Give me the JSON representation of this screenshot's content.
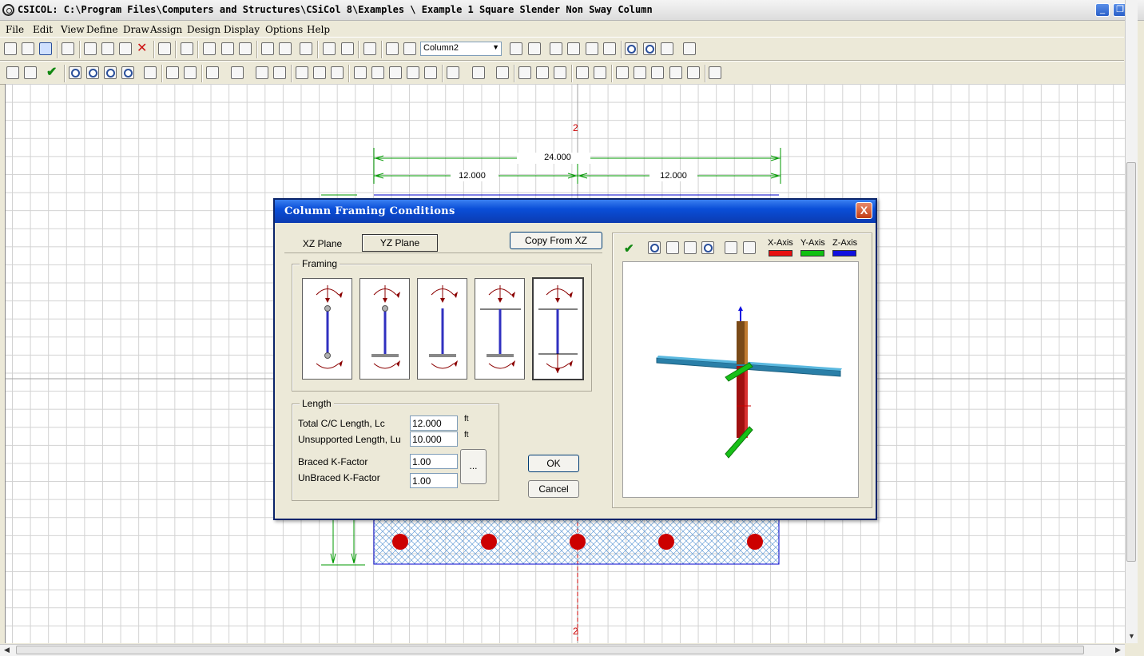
{
  "window": {
    "title": "CSICOL: C:\\Program Files\\Computers and Structures\\CSiCol 8\\Examples \\ Example 1 Square Slender Non Sway Column"
  },
  "menu": [
    "File",
    "Edit",
    "View",
    "Define",
    "Draw",
    "Assign",
    "Design",
    "Display",
    "Options",
    "Help"
  ],
  "toolbar": {
    "section_combo_value": "Column2"
  },
  "canvas": {
    "axis_label_top": "2",
    "axis_label_bottom": "2",
    "dim_total": "24.000",
    "dim_left": "12.000",
    "dim_right": "12.000"
  },
  "dialog": {
    "title": "Column Framing Conditions",
    "close": "X",
    "tabs": [
      "XZ Plane",
      "YZ Plane"
    ],
    "active_tab": "YZ Plane",
    "copy_button": "Copy From XZ",
    "framing": {
      "label": "Framing",
      "options": [
        "pinned-pinned",
        "pinned-base",
        "free-base",
        "braced-base",
        "braced-braced"
      ],
      "selected": "braced-braced"
    },
    "length": {
      "label": "Length",
      "total_label": "Total  C/C Length, Lc",
      "total_value": "12.000",
      "total_unit": "ft",
      "unsupported_label": "Unsupported  Length, Lu",
      "unsupported_value": "10.000",
      "unsupported_unit": "ft",
      "braced_label": "Braced K-Factor",
      "braced_value": "1.00",
      "unbraced_label": "UnBraced K-Factor",
      "unbraced_value": "1.00",
      "ellipsis": "..."
    },
    "ok": "OK",
    "cancel": "Cancel",
    "preview": {
      "x_axis": "X-Axis",
      "y_axis": "Y-Axis",
      "z_axis": "Z-Axis",
      "x_color": "#e81010",
      "y_color": "#10c010",
      "z_color": "#1010e0"
    }
  }
}
